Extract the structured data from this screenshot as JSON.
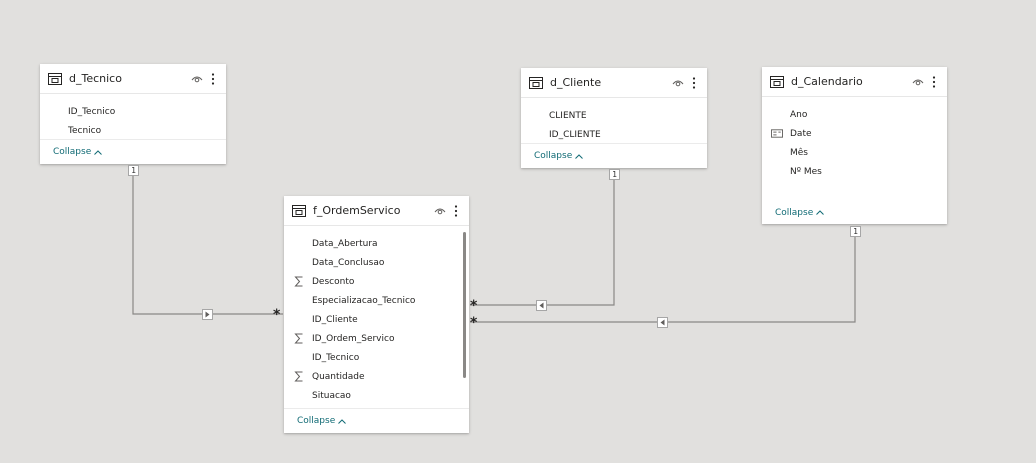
{
  "tables": [
    {
      "name": "d_Tecnico",
      "fields": [
        {
          "label": "ID_Tecnico",
          "icon": "none"
        },
        {
          "label": "Tecnico",
          "icon": "none"
        }
      ],
      "collapse_label": "Collapse"
    },
    {
      "name": "d_Cliente",
      "fields": [
        {
          "label": "CLIENTE",
          "icon": "none"
        },
        {
          "label": "ID_CLIENTE",
          "icon": "none"
        }
      ],
      "collapse_label": "Collapse"
    },
    {
      "name": "d_Calendario",
      "fields": [
        {
          "label": "Ano",
          "icon": "none"
        },
        {
          "label": "Date",
          "icon": "date-hierarchy-icon"
        },
        {
          "label": "Mês",
          "icon": "none"
        },
        {
          "label": "Nº Mes",
          "icon": "none"
        }
      ],
      "collapse_label": "Collapse"
    },
    {
      "name": "f_OrdemServico",
      "fields": [
        {
          "label": "Data_Abertura",
          "icon": "none"
        },
        {
          "label": "Data_Conclusao",
          "icon": "none"
        },
        {
          "label": "Desconto",
          "icon": "sigma-icon"
        },
        {
          "label": "Especializacao_Tecnico",
          "icon": "none"
        },
        {
          "label": "ID_Cliente",
          "icon": "none"
        },
        {
          "label": "ID_Ordem_Servico",
          "icon": "sigma-icon"
        },
        {
          "label": "ID_Tecnico",
          "icon": "none"
        },
        {
          "label": "Quantidade",
          "icon": "sigma-icon"
        },
        {
          "label": "Situacao",
          "icon": "none"
        }
      ],
      "collapse_label": "Collapse"
    }
  ],
  "relationships": [
    {
      "from": "f_OrdemServico",
      "to": "d_Tecnico",
      "one_label": "1",
      "many_label": "*"
    },
    {
      "from": "f_OrdemServico",
      "to": "d_Cliente",
      "one_label": "1",
      "many_label": "*"
    },
    {
      "from": "f_OrdemServico",
      "to": "d_Calendario",
      "one_label": "1",
      "many_label": "*"
    }
  ],
  "colors": {
    "canvas": "#e1e0de",
    "line": "#8a8886",
    "collapse_text": "#116b75",
    "text": "#252423"
  }
}
